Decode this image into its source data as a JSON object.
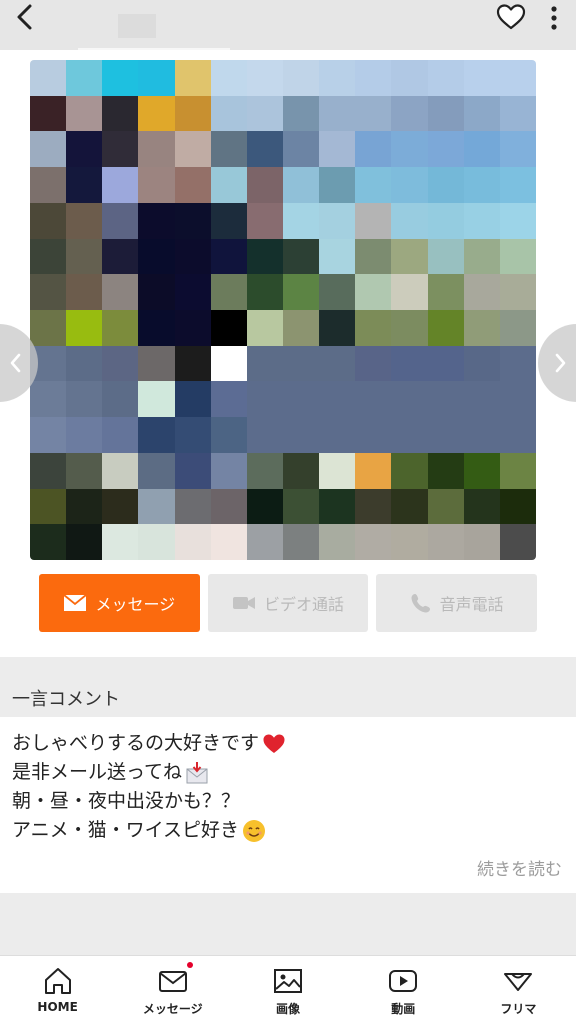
{
  "actions": {
    "message_label": "メッセージ",
    "video_label": "ビデオ通話",
    "voice_label": "音声電話"
  },
  "comment": {
    "header": "一言コメント",
    "lines": [
      "おしゃべりするの大好きです",
      "是非メール送ってね",
      "朝・昼・夜中出没かも？？",
      "アニメ・猫・ワイスピ好き"
    ],
    "read_more": "続きを読む"
  },
  "nav": {
    "items": [
      {
        "label": "HOME",
        "icon": "home-icon"
      },
      {
        "label": "メッセージ",
        "icon": "mail-icon",
        "badge": true
      },
      {
        "label": "画像",
        "icon": "image-icon"
      },
      {
        "label": "動画",
        "icon": "video-play-icon"
      },
      {
        "label": "フリマ",
        "icon": "flea-market-icon"
      }
    ]
  },
  "colors": {
    "accent": "#fb6a0e",
    "badge": "#e4002b",
    "disabled_bg": "#e8e8e8",
    "disabled_text": "#b9b9b9"
  },
  "photo": {
    "pixelated": true,
    "mosaic_colors": [
      [
        "#b8cce0",
        "#6ec8dc",
        "#1ec0e0",
        "#20bce0",
        "#e0c46c",
        "#c0d8ec",
        "#c4d8ec",
        "#c0d4e8",
        "#b8d0e8",
        "#b4cce8",
        "#b0c8e4",
        "#b4cce8",
        "#b8d0ec",
        "#b8d0ec"
      ],
      [
        "#3a2226",
        "#a89494",
        "#2a2830",
        "#e0a82a",
        "#c89030",
        "#a8c4dc",
        "#acc4dc",
        "#7894ac",
        "#98b0cc",
        "#98b0cc",
        "#8ca4c4",
        "#849cbc",
        "#8ca8c8",
        "#98b4d4"
      ],
      [
        "#9cacc0",
        "#14143a",
        "#302c38",
        "#988480",
        "#c0aca4",
        "#607484",
        "#3c587c",
        "#6c84a4",
        "#a4b8d4",
        "#78a4d4",
        "#7cacd8",
        "#7ca8d8",
        "#74a8d8",
        "#80b0dc"
      ],
      [
        "#7c706c",
        "#14183c",
        "#9ca8dc",
        "#9c8480",
        "#947068",
        "#98c8d8",
        "#7c6468",
        "#90c0d8",
        "#6c9cb0",
        "#80c0dc",
        "#7ebcdc",
        "#74b8d8",
        "#78bcdc",
        "#7cc0e0"
      ],
      [
        "#4c4838",
        "#6c5c4c",
        "#5c6484",
        "#0c0c2c",
        "#0c0e2c",
        "#1c2c3c",
        "#886c70",
        "#a4d4e4",
        "#a4d0e0",
        "#b4b4b4",
        "#98cce0",
        "#94cce0",
        "#98d0e4",
        "#9cd4e8"
      ],
      [
        "#3c4438",
        "#646050",
        "#1c1c38",
        "#080c2c",
        "#0c0c2c",
        "#10143c",
        "#14302c",
        "#2c4034",
        "#a8d4e0",
        "#7c8c70",
        "#9ca880",
        "#98c0c0",
        "#98ac8c",
        "#a8c4a8"
      ],
      [
        "#545444",
        "#6c5c4c",
        "#8c8480",
        "#0c0c28",
        "#0c0c30",
        "#6c7c5c",
        "#2c4c2c",
        "#5c8444",
        "#586c5c",
        "#b0c8b0",
        "#ccccbc",
        "#7c9060",
        "#a8a89c",
        "#a8ac98"
      ],
      [
        "#6c7448",
        "#98bc10",
        "#7c8c3c",
        "#080c2c",
        "#0c0c2c",
        "#000000",
        "#b8c8a0",
        "#8c9470",
        "#1c2c2c",
        "#7c8c58",
        "#7c8c60",
        "#648428",
        "#909c78",
        "#8c9888"
      ],
      [
        "#647490",
        "#5c6c88",
        "#5c6684",
        "#6c6868",
        "#1c1c1c",
        "#ffffff",
        "#5c6c88",
        "#5c6c88",
        "#5c6c88",
        "#586488",
        "#54648c",
        "#54648c",
        "#586888",
        "#5c6c8c"
      ],
      [
        "#6c7c98",
        "#647490",
        "#5c6c88",
        "#d0e8dc",
        "#243c64",
        "#5c6c94",
        "#5c6c8c",
        "#5c6c8c",
        "#5c6c8c",
        "#5c6c8c",
        "#5c6c8c",
        "#5c6c8c",
        "#5c6c8c",
        "#5c6c8c"
      ],
      [
        "#7484a4",
        "#6c7ca0",
        "#64749a",
        "#2c446c",
        "#344c74",
        "#4c6484",
        "#5c6c8c",
        "#5c6c8c",
        "#5c6c8c",
        "#5c6c8c",
        "#5c6c8c",
        "#5c6c8c",
        "#5c6c8c",
        "#5c6c8c"
      ],
      [
        "#3c443c",
        "#545c4c",
        "#c8ccc0",
        "#5c6c84",
        "#3c4c78",
        "#7484a4",
        "#5c6c5c",
        "#34402c",
        "#dce4d4",
        "#e8a444",
        "#4c642c",
        "#243c14",
        "#345c14",
        "#6c8444"
      ],
      [
        "#4c5424",
        "#1c2418",
        "#2c2c1c",
        "#90a0b0",
        "#6c6c70",
        "#6c6468",
        "#0c1c14",
        "#3c5034",
        "#1c3420",
        "#3c3c2c",
        "#2c341c",
        "#5c6c3c",
        "#24341c",
        "#1c2c0c"
      ],
      [
        "#1c2c1c",
        "#101814",
        "#dce8e0",
        "#d8e4dc",
        "#e8e0dc",
        "#f0e4e0",
        "#9ca0a4",
        "#7c8080",
        "#a8aca0",
        "#b0aca4",
        "#b0aca0",
        "#aca8a0",
        "#a8a49c",
        "#4c4c4c"
      ]
    ]
  }
}
